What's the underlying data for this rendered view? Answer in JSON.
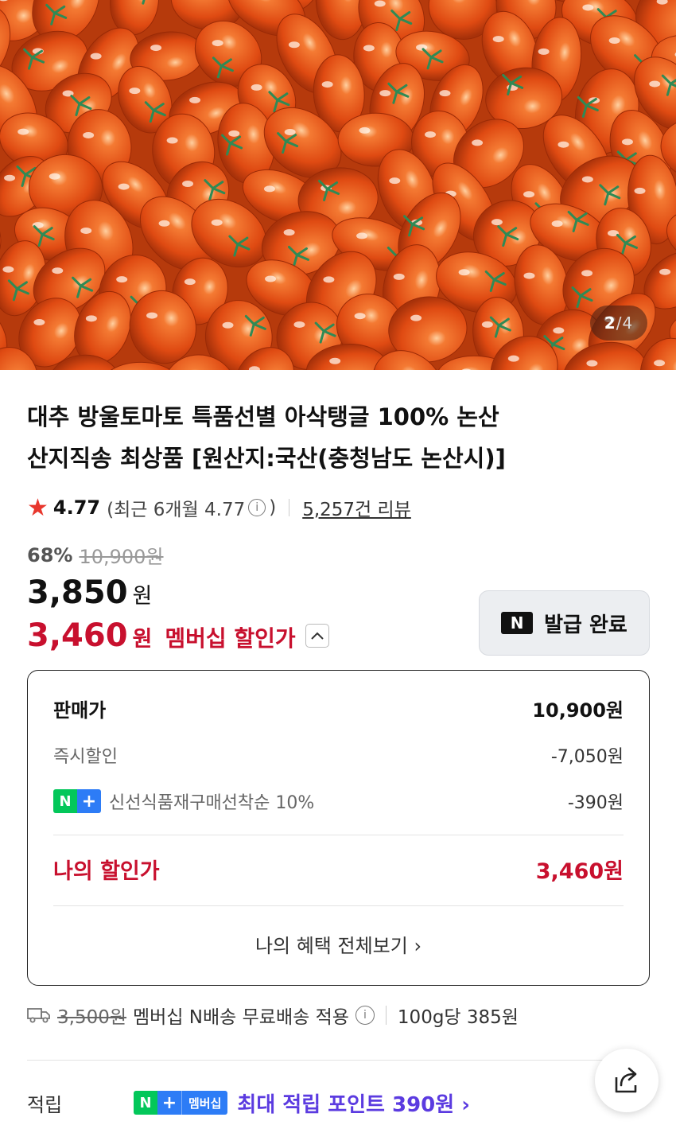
{
  "gallery": {
    "current": "2",
    "separator": "/",
    "total": "4"
  },
  "product": {
    "title_line1": "대추 방울토마토 특품선별 아삭탱글 100% 논산",
    "title_line2": "산지직송 최상품 [원산지:국산(충청남도 논산시)]"
  },
  "rating": {
    "score": "4.77",
    "recent_open": "(최근 6개월 4.77",
    "recent_close": ")",
    "reviews": "5,257건 리뷰"
  },
  "pricing": {
    "discount_percent": "68%",
    "original_price": "10,900원",
    "price_num": "3,850",
    "price_unit": "원",
    "member_price_num": "3,460",
    "member_price_unit": "원",
    "member_label": "멤버십 할인가",
    "coupon_badge": "N",
    "coupon_label": "발급 완료"
  },
  "breakdown": {
    "sale_label": "판매가",
    "sale_value": "10,900원",
    "instant_label": "즉시할인",
    "instant_value": "-7,050원",
    "badge_n": "N",
    "badge_plus": "+",
    "coupon_label": "신선식품재구매선착순 10%",
    "coupon_value": "-390원",
    "my_price_label": "나의 할인가",
    "my_price_value": "3,460원",
    "more_label": "나의 혜택 전체보기 ›"
  },
  "shipping": {
    "original_fee": "3,500원",
    "text": "멤버십 N배송 무료배송 적용",
    "unit_price": "100g당 385원"
  },
  "points": {
    "label": "적립",
    "badge_n": "N",
    "badge_plus": "+",
    "badge_member": "멤버십",
    "text": "최대 적립 포인트 390원 ›"
  },
  "colors": {
    "accent_red": "#c8102e",
    "naver_green": "#03c75a",
    "plus_blue": "#2d7cf6",
    "points_purple": "#5b3be0",
    "star": "#e8372d"
  }
}
